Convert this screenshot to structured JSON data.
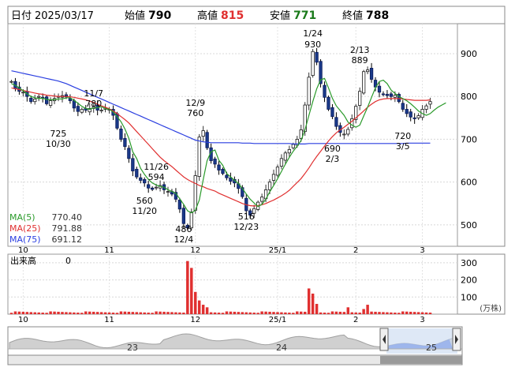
{
  "header": {
    "date_label": "日付",
    "date": "2025/03/17",
    "open_label": "始値",
    "open": "790",
    "high_label": "高値",
    "high": "815",
    "low_label": "安値",
    "low": "771",
    "close_label": "終値",
    "close": "788"
  },
  "legend": {
    "ma5": {
      "label": "MA(5)",
      "value": "770.40",
      "color": "#2a9a2a"
    },
    "ma25": {
      "label": "MA(25)",
      "value": "791.88",
      "color": "#e03030"
    },
    "ma75": {
      "label": "MA(75)",
      "value": "691.12",
      "color": "#2a3ee0"
    }
  },
  "colors": {
    "up": "#1a7a1a",
    "down": "#2a3ee0",
    "vol": "#e03030",
    "price_high": "#e03030",
    "price_low": "#1a7a1a"
  },
  "price_axis": {
    "ticks": [
      "900",
      "800",
      "700",
      "600",
      "500"
    ]
  },
  "volume_panel": {
    "label": "出来高",
    "value": "0",
    "ticks": [
      "300",
      "200",
      "100"
    ],
    "unit": "(万株)"
  },
  "month_labels": [
    "10",
    "11",
    "12",
    "25/1",
    "2",
    "3"
  ],
  "navigator": {
    "year_labels": [
      "23",
      "24",
      "25"
    ]
  },
  "annotations": [
    {
      "text": "1/24",
      "sub": "930"
    },
    {
      "text": "2/13",
      "sub": "889"
    },
    {
      "text": "11/7",
      "sub": "780"
    },
    {
      "text": "12/9",
      "sub": "760"
    },
    {
      "text": "725",
      "sub": "10/30"
    },
    {
      "text": "11/26",
      "sub": "594"
    },
    {
      "text": "560",
      "sub": "11/20"
    },
    {
      "text": "486",
      "sub": "12/4"
    },
    {
      "text": "516",
      "sub": "12/23"
    },
    {
      "text": "690",
      "sub": "2/3"
    },
    {
      "text": "720",
      "sub": "3/5"
    }
  ],
  "chart_data": {
    "type": "candlestick",
    "y_range": [
      450,
      970
    ],
    "close_series": [
      835,
      818,
      812,
      810,
      800,
      788,
      794,
      800,
      797,
      783,
      790,
      795,
      800,
      802,
      799,
      790,
      773,
      765,
      770,
      768,
      772,
      776,
      768,
      768,
      773,
      770,
      756,
      726,
      700,
      683,
      655,
      626,
      612,
      604,
      598,
      586,
      583,
      588,
      592,
      582,
      578,
      572,
      560,
      537,
      503,
      493,
      530,
      615,
      705,
      720,
      680,
      650,
      642,
      628,
      620,
      610,
      602,
      598,
      585,
      566,
      533,
      523,
      538,
      553,
      565,
      582,
      600,
      618,
      635,
      655,
      668,
      676,
      688,
      700,
      722,
      780,
      845,
      905,
      880,
      830,
      798,
      770,
      753,
      730,
      716,
      712,
      723,
      748,
      777,
      812,
      858,
      862,
      840,
      822,
      810,
      805,
      802,
      800,
      803,
      788,
      770,
      760,
      752,
      748,
      755,
      770,
      778,
      788
    ],
    "ma5": [
      830,
      826,
      820,
      813,
      806,
      800,
      797,
      795,
      796,
      793,
      792,
      793,
      794,
      794,
      797,
      797,
      791,
      784,
      777,
      772,
      770,
      773,
      774,
      776,
      772,
      770,
      764,
      753,
      741,
      724,
      702,
      671,
      655,
      632,
      618,
      606,
      598,
      593,
      590,
      588,
      582,
      578,
      574,
      561,
      548,
      533,
      528,
      534,
      558,
      606,
      650,
      671,
      675,
      651,
      639,
      620,
      612,
      604,
      597,
      585,
      572,
      560,
      551,
      543,
      548,
      560,
      577,
      592,
      608,
      625,
      642,
      658,
      672,
      684,
      697,
      722,
      756,
      788,
      818,
      839,
      842,
      820,
      796,
      778,
      767,
      756,
      740,
      733,
      728,
      733,
      754,
      775,
      798,
      820,
      835,
      838,
      830,
      815,
      807,
      800,
      795,
      790,
      783,
      775,
      766,
      760,
      756,
      760,
      768,
      775,
      780,
      785
    ],
    "ma25": [
      820,
      818,
      816,
      814,
      812,
      810,
      808,
      806,
      805,
      803,
      802,
      801,
      800,
      800,
      800,
      799,
      798,
      796,
      794,
      792,
      789,
      786,
      782,
      778,
      775,
      771,
      766,
      760,
      753,
      746,
      738,
      728,
      718,
      708,
      698,
      688,
      678,
      668,
      658,
      650,
      643,
      636,
      628,
      620,
      612,
      606,
      601,
      597,
      592,
      589,
      585,
      582,
      579,
      574,
      570,
      566,
      562,
      558,
      554,
      550,
      547,
      545,
      544,
      545,
      547,
      550,
      554,
      558,
      563,
      568,
      574,
      581,
      590,
      599,
      608,
      620,
      633,
      647,
      660,
      672,
      684,
      696,
      706,
      715,
      722,
      728,
      735,
      742,
      750,
      758,
      766,
      775,
      782,
      788,
      792,
      794,
      795,
      795,
      795,
      795,
      794,
      793,
      792,
      791,
      791,
      791,
      791,
      792
    ],
    "ma75": [
      860,
      858,
      856,
      854,
      852,
      850,
      848,
      846,
      844,
      842,
      840,
      838,
      836,
      833,
      830,
      826,
      822,
      818,
      814,
      810,
      806,
      802,
      798,
      794,
      790,
      786,
      782,
      778,
      774,
      770,
      766,
      762,
      758,
      754,
      750,
      746,
      742,
      738,
      734,
      730,
      726,
      722,
      718,
      714,
      710,
      706,
      702,
      698,
      696,
      694,
      693,
      692,
      692,
      692,
      692,
      692,
      692,
      692,
      692,
      691,
      691,
      691,
      690,
      690,
      690,
      690,
      690,
      690,
      690,
      690,
      690,
      690,
      689,
      689,
      689,
      689,
      690,
      690,
      690,
      690,
      690,
      690,
      690,
      690,
      690,
      690,
      690,
      690,
      690,
      690,
      690,
      690,
      690,
      690,
      690,
      690,
      690,
      690,
      690,
      690,
      690,
      691,
      691,
      691,
      691,
      691,
      691,
      691
    ],
    "volume_max": 350,
    "volume_spikes": {
      "45": 310,
      "46": 270,
      "47": 130,
      "48": 80,
      "49": 55,
      "50": 40,
      "76": 150,
      "77": 120,
      "78": 60,
      "86": 40,
      "90": 30,
      "91": 55
    },
    "price_labels": [
      {
        "label": "1/24 930",
        "i": 77,
        "v": 930
      },
      {
        "label": "2/13 889",
        "i": 89,
        "v": 889
      },
      {
        "label": "11/7 780",
        "i": 21,
        "v": 780
      },
      {
        "label": "12/9 760",
        "i": 47,
        "v": 760
      },
      {
        "label": "10/30 725",
        "i": 16,
        "v": 725
      },
      {
        "label": "11/26 594",
        "i": 37,
        "v": 594
      },
      {
        "label": "11/20 560",
        "i": 34,
        "v": 560
      },
      {
        "label": "12/4 486",
        "i": 44,
        "v": 486
      },
      {
        "label": "12/23 516",
        "i": 60,
        "v": 516
      },
      {
        "label": "2/3 690",
        "i": 82,
        "v": 690
      },
      {
        "label": "3/5 720",
        "i": 100,
        "v": 720
      }
    ]
  }
}
